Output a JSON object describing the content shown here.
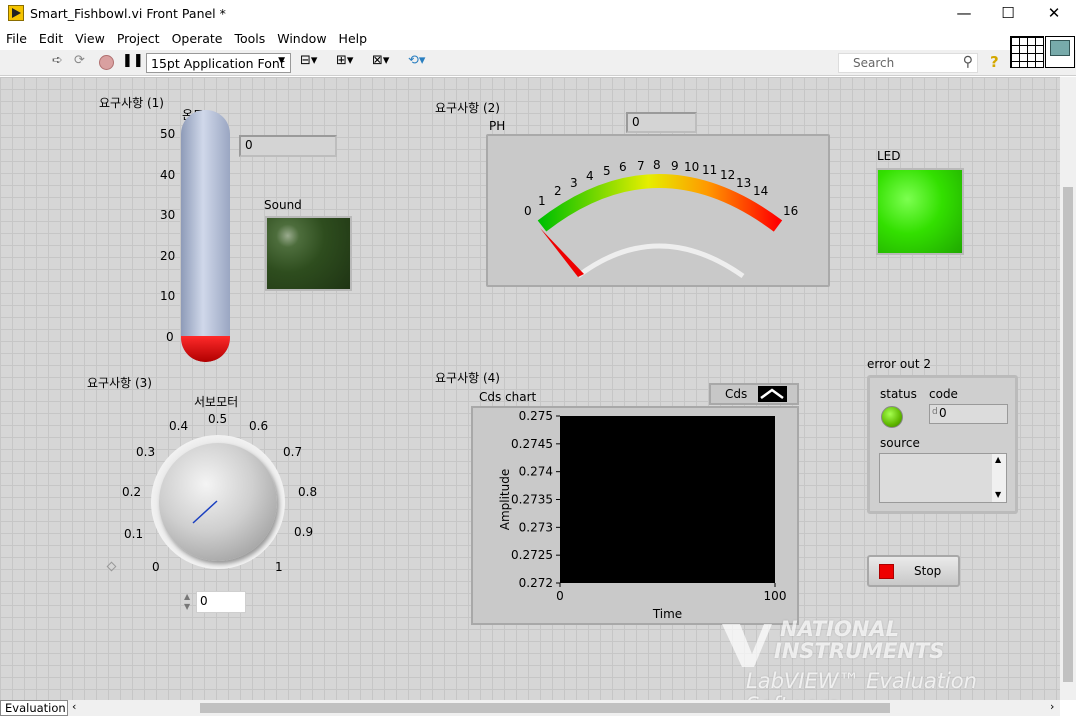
{
  "window": {
    "title": "Smart_Fishbowl.vi Front Panel *",
    "minimize": "—",
    "maximize": "☐",
    "close": "✕"
  },
  "menu": [
    "File",
    "Edit",
    "View",
    "Project",
    "Operate",
    "Tools",
    "Window",
    "Help"
  ],
  "toolbar": {
    "font": "15pt Application Font",
    "search_placeholder": "Search",
    "help": "?"
  },
  "req1": {
    "label": "요구사항 (1)",
    "thermo_label": "온도",
    "thermo_value": 0,
    "thermo_ticks": [
      "50",
      "40",
      "30",
      "20",
      "10",
      "0"
    ],
    "numeric": "0",
    "sound_label": "Sound"
  },
  "req2": {
    "label": "요구사항 (2)",
    "gauge_label": "PH",
    "numeric": "0",
    "gauge_value": 0,
    "gauge_ticks": [
      "0",
      "1",
      "2",
      "3",
      "4",
      "5",
      "6",
      "7",
      "8",
      "9",
      "10",
      "11",
      "12",
      "13",
      "14",
      "16"
    ],
    "led_label": "LED"
  },
  "req3": {
    "label": "요구사항 (3)",
    "knob_label": "서보모터",
    "knob_value": 0,
    "knob_ticks": [
      "0",
      "0.1",
      "0.2",
      "0.3",
      "0.4",
      "0.5",
      "0.6",
      "0.7",
      "0.8",
      "0.9",
      "1"
    ],
    "numeric": "0"
  },
  "req4": {
    "label": "요구사항 (4)",
    "chart_label": "Cds chart",
    "legend": "Cds"
  },
  "chart_data": {
    "type": "line",
    "title": "Cds chart",
    "xlabel": "Time",
    "ylabel": "Amplitude",
    "xlim": [
      0,
      100
    ],
    "ylim": [
      0.272,
      0.275
    ],
    "x_ticks": [
      "0",
      "100"
    ],
    "y_ticks": [
      "0.275",
      "0.2745",
      "0.274",
      "0.2735",
      "0.273",
      "0.2725",
      "0.272"
    ],
    "series": [
      {
        "name": "Cds",
        "values": []
      }
    ]
  },
  "error_out": {
    "label": "error out 2",
    "status_label": "status",
    "code_label": "code",
    "code_value": "0",
    "code_prefix": "d",
    "source_label": "source",
    "status_color": "#5fb800"
  },
  "stop": {
    "label": "Stop",
    "color": "#ee0000"
  },
  "watermark": {
    "line1": "NATIONAL",
    "line2": "INSTRUMENTS",
    "line3": "LabVIEW™ Evaluation Software"
  },
  "status": {
    "tab": "Evaluation"
  },
  "colors": {
    "led_on": "#33e000",
    "sound_off": "#2e4d1e",
    "thermo_bulb": "#dd0000"
  }
}
